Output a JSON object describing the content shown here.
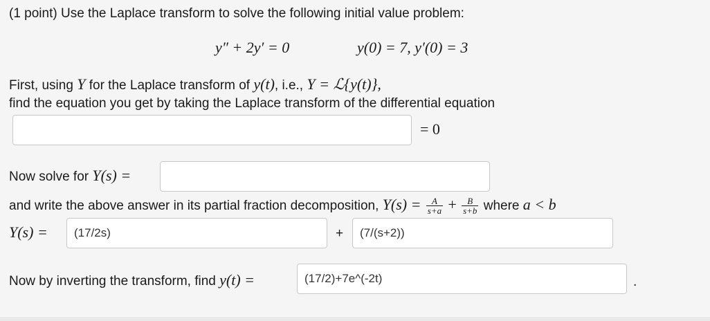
{
  "problem": {
    "intro": "(1 point) Use the Laplace transform to solve the following initial value problem:",
    "equation_lhs": "y″ + 2y′ = 0",
    "initial_conditions": "y(0) = 7,  y′(0) = 3"
  },
  "step1": {
    "line1_prefix": "First, using",
    "Y": "Y",
    "line1_mid": "for the Laplace transform of",
    "yt": "y(t)",
    "line1_ie": ", i.e.,",
    "definition": "Y = ℒ{y(t)},",
    "line2": "find the equation you get by taking the Laplace transform of the differential equation",
    "input_value": "",
    "equals_zero": "= 0"
  },
  "step2": {
    "label": "Now solve for",
    "Ys_eq": "Y(s) =",
    "input_value": ""
  },
  "step3": {
    "text": "and write the above answer in its partial fraction decomposition,",
    "Ys_eq": "Y(s) =",
    "frac1_num": "A",
    "frac1_den": "s+a",
    "plus": "+",
    "frac2_num": "B",
    "frac2_den": "s+b",
    "where": "where",
    "condition": "a < b",
    "row_label": "Y(s) =",
    "input_A": "(17/2s)",
    "plus_sign": "+",
    "input_B": "(7/(s+2))"
  },
  "step4": {
    "label": "Now by inverting the transform, find",
    "yt_eq": "y(t) =",
    "input_value": "(17/2)+7e^(-2t)",
    "period": "."
  }
}
